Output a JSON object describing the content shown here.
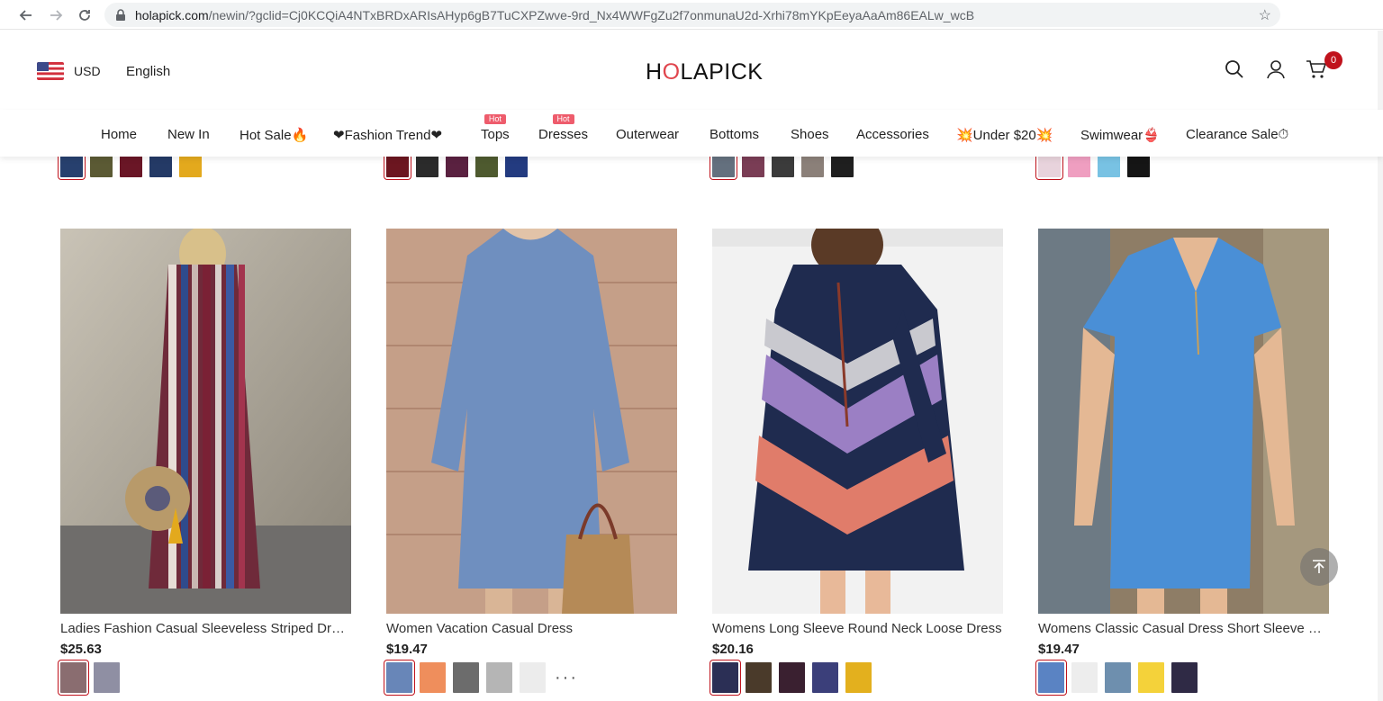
{
  "browser": {
    "url_host": "holapick.com",
    "url_rest": "/newin/?gclid=Cj0KCQiA4NTxBRDxARIsAHyp6gB7TuCXPZwve-9rd_Nx4WWFgZu2f7onmunaU2d-Xrhi78mYKpEeyaAaAm86EALw_wcB"
  },
  "header": {
    "currency": "USD",
    "language": "English",
    "logo_left": "H",
    "logo_o": "O",
    "logo_right": "LAPICK",
    "cart_count": "0"
  },
  "menu": {
    "items": [
      {
        "label": "Home"
      },
      {
        "label": "New In"
      },
      {
        "label": "Hot Sale🔥"
      },
      {
        "label": "❤Fashion Trend❤"
      },
      {
        "label": "Tops",
        "tag": "Hot"
      },
      {
        "label": "Dresses",
        "tag": "Hot"
      },
      {
        "label": "Outerwear"
      },
      {
        "label": "Bottoms"
      },
      {
        "label": "Shoes"
      },
      {
        "label": "Accessories"
      },
      {
        "label": "💥Under $20💥"
      },
      {
        "label": "Swimwear👙"
      },
      {
        "label": "Clearance Sale⏱"
      }
    ]
  },
  "products": [
    {
      "name": "Ladies Fashion Casual Sleeveless Striped Dress",
      "price": "$25.63"
    },
    {
      "name": "Women Vacation Casual Dress",
      "price": "$19.47"
    },
    {
      "name": "Womens Long Sleeve Round Neck Loose Dress",
      "price": "$20.16"
    },
    {
      "name": "Womens Classic Casual Dress Short Sleeve Shif...",
      "price": "$19.47"
    }
  ],
  "colors": {
    "accent_red": "#c0121c",
    "hot_tag": "#ee5c6c"
  }
}
